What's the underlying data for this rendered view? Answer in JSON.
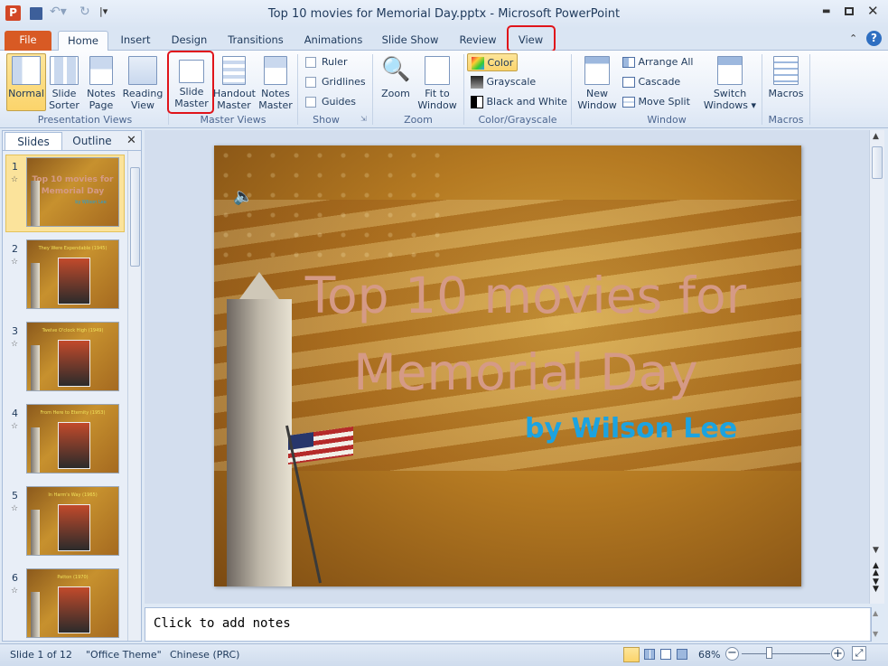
{
  "window": {
    "title": "Top 10 movies for Memorial Day.pptx - Microsoft PowerPoint"
  },
  "tabs": [
    "File",
    "Home",
    "Insert",
    "Design",
    "Transitions",
    "Animations",
    "Slide Show",
    "Review",
    "View"
  ],
  "ribbon": {
    "presentation_views": {
      "label": "Presentation Views",
      "normal": "Normal",
      "slide_sorter_1": "Slide",
      "slide_sorter_2": "Sorter",
      "notes_page_1": "Notes",
      "notes_page_2": "Page",
      "reading_view_1": "Reading",
      "reading_view_2": "View"
    },
    "master_views": {
      "label": "Master Views",
      "slide_master_1": "Slide",
      "slide_master_2": "Master",
      "handout_master_1": "Handout",
      "handout_master_2": "Master",
      "notes_master_1": "Notes",
      "notes_master_2": "Master"
    },
    "show": {
      "label": "Show",
      "ruler": "Ruler",
      "gridlines": "Gridlines",
      "guides": "Guides"
    },
    "zoom": {
      "label": "Zoom",
      "zoom": "Zoom",
      "fit_1": "Fit to",
      "fit_2": "Window"
    },
    "color": {
      "label": "Color/Grayscale",
      "color": "Color",
      "grayscale": "Grayscale",
      "bw": "Black and White"
    },
    "window": {
      "label": "Window",
      "new_1": "New",
      "new_2": "Window",
      "arrange": "Arrange All",
      "cascade": "Cascade",
      "move_split": "Move Split",
      "switch_1": "Switch",
      "switch_2": "Windows"
    },
    "macros": {
      "label": "Macros",
      "macros": "Macros"
    }
  },
  "panel": {
    "tab_slides": "Slides",
    "tab_outline": "Outline"
  },
  "thumbnails": [
    {
      "n": "1",
      "title": "Top 10 movies for Memorial Day",
      "sub": "by Wilson Lee"
    },
    {
      "n": "2",
      "title": "They Were Expendable (1945)",
      "sub": ""
    },
    {
      "n": "3",
      "title": "Twelve O'clock High (1949)",
      "sub": ""
    },
    {
      "n": "4",
      "title": "From Here to Eternity (1953)",
      "sub": ""
    },
    {
      "n": "5",
      "title": "In Harm's Way (1965)",
      "sub": ""
    },
    {
      "n": "6",
      "title": "Patton (1970)",
      "sub": ""
    }
  ],
  "slide": {
    "title_1": "Top 10 movies for",
    "title_2": "Memorial Day",
    "subtitle": "by Wilson Lee"
  },
  "notes": {
    "placeholder": "Click to add notes"
  },
  "status": {
    "slide": "Slide 1 of 12",
    "theme": "\"Office Theme\"",
    "language": "Chinese (PRC)",
    "zoom": "68%"
  },
  "colors": {
    "title": "#d59a86",
    "subtitle": "#1ca3e0",
    "file_tab": "#d85a24",
    "highlight": "#e0141a"
  }
}
